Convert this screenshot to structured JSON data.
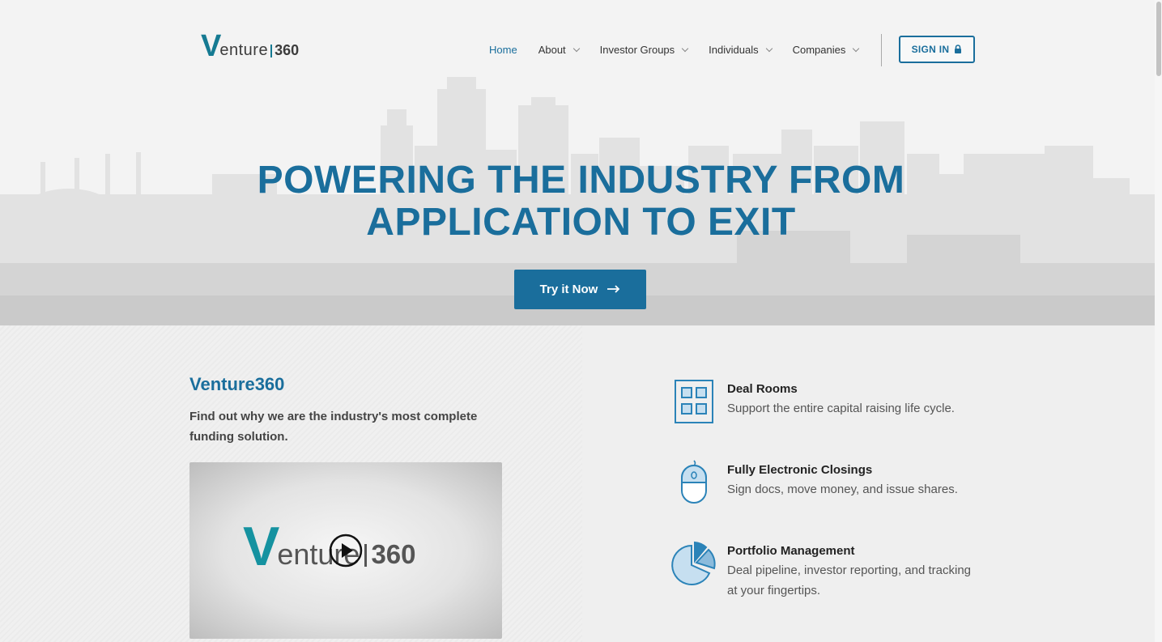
{
  "brand": {
    "logo_v": "V",
    "logo_rest": "enture",
    "logo_num": "360"
  },
  "nav": {
    "items": [
      {
        "label": "Home",
        "active": true,
        "has_dropdown": false
      },
      {
        "label": "About",
        "active": false,
        "has_dropdown": true
      },
      {
        "label": "Investor Groups",
        "active": false,
        "has_dropdown": true
      },
      {
        "label": "Individuals",
        "active": false,
        "has_dropdown": true
      },
      {
        "label": "Companies",
        "active": false,
        "has_dropdown": true
      }
    ],
    "signin_label": "SIGN IN",
    "signin_icon": "lock-icon"
  },
  "hero": {
    "headline_line1": "POWERING THE INDUSTRY FROM",
    "headline_line2": "APPLICATION TO EXIT",
    "cta_label": "Try it Now",
    "cta_icon": "arrow-right-icon"
  },
  "intro": {
    "title": "Venture360",
    "description": "Find out why we are the industry's most complete funding solution.",
    "video_logo_v": "V",
    "video_logo_rest": "enture",
    "video_logo_num": "360"
  },
  "features": [
    {
      "title": "Deal Rooms",
      "description": "Support the entire capital raising life cycle.",
      "icon": "grid-icon"
    },
    {
      "title": "Fully Electronic Closings",
      "description": "Sign docs, move money, and issue shares.",
      "icon": "mouse-icon"
    },
    {
      "title": "Portfolio Management",
      "description": "Deal pipeline, investor reporting, and tracking at your fingertips.",
      "icon": "pie-chart-icon"
    }
  ],
  "colors": {
    "brand_blue": "#1a6e9c",
    "teal": "#157a92",
    "icon_blue": "#2b83b8",
    "icon_fill": "#c6dff0"
  }
}
